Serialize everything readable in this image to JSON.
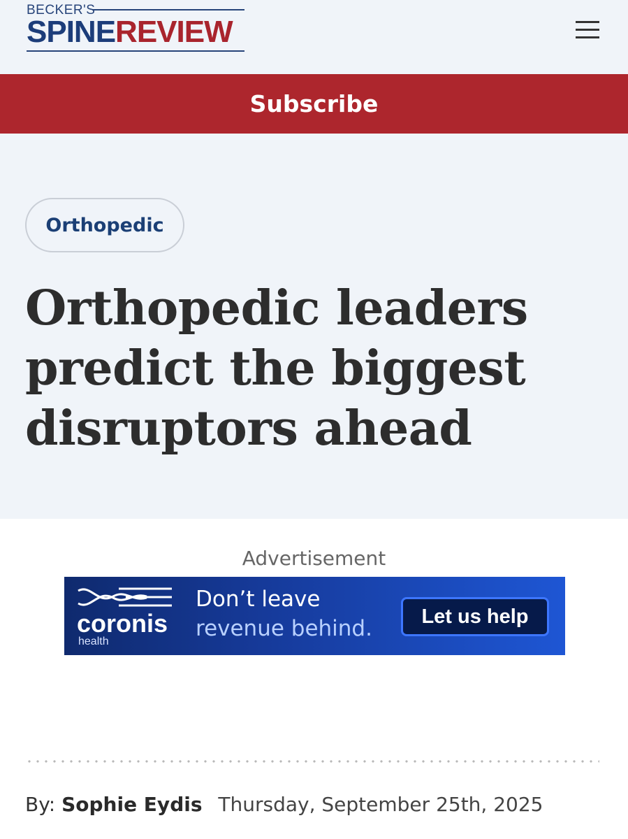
{
  "header": {
    "logo_small": "BECKER'S",
    "logo_spine": "SPINE",
    "logo_review": "REVIEW"
  },
  "subscribe": {
    "label": "Subscribe"
  },
  "article": {
    "category": "Orthopedic",
    "headline": "Orthopedic leaders predict the biggest disruptors ahead"
  },
  "ad": {
    "label": "Advertisement",
    "brand": "coronis",
    "brand_sub": "health",
    "line1": "Don’t leave",
    "line2": "revenue behind.",
    "cta": "Let us help"
  },
  "byline": {
    "by_label": "By:",
    "author": "Sophie Eydis",
    "date": "Thursday, September 25th, 2025"
  },
  "colors": {
    "brand_navy": "#1c3d7a",
    "brand_red": "#a9242d",
    "subscribe_bg": "#ad262d",
    "hero_bg": "#f0f4f9"
  }
}
